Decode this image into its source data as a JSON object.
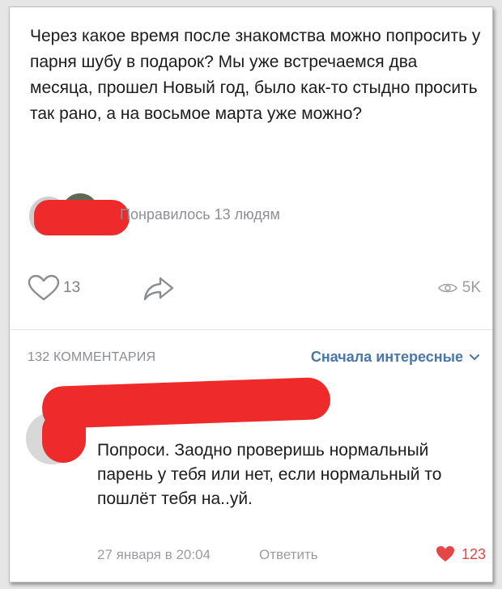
{
  "post": {
    "text": "Через какое время после знакомства можно попросить у парня шубу в подарок? Мы уже встречаемся два месяца, прошел Новый год, было как-то стыдно просить так рано, а на восьмое марта уже можно?"
  },
  "likers": {
    "text": "Понравилось 13 людям"
  },
  "actions": {
    "likes": "13",
    "views": "5K"
  },
  "comments": {
    "count_label": "132 КОММЕНТАРИЯ",
    "sort_label": "Сначала интересные"
  },
  "comment": {
    "text": "Попроси. Заодно проверишь нормальный парень у тебя или нет, если нормальный то пошлёт тебя на..уй.",
    "date": "27 января в 20:04",
    "reply_label": "Ответить",
    "likes": "123"
  },
  "colors": {
    "accent": "#4a76a8",
    "redaction": "#ee2a2a",
    "like_red": "#e64646",
    "muted": "#9a9da2"
  },
  "icons": [
    "heart-icon",
    "share-icon",
    "eye-icon",
    "chevron-down-icon",
    "heart-filled-icon"
  ]
}
